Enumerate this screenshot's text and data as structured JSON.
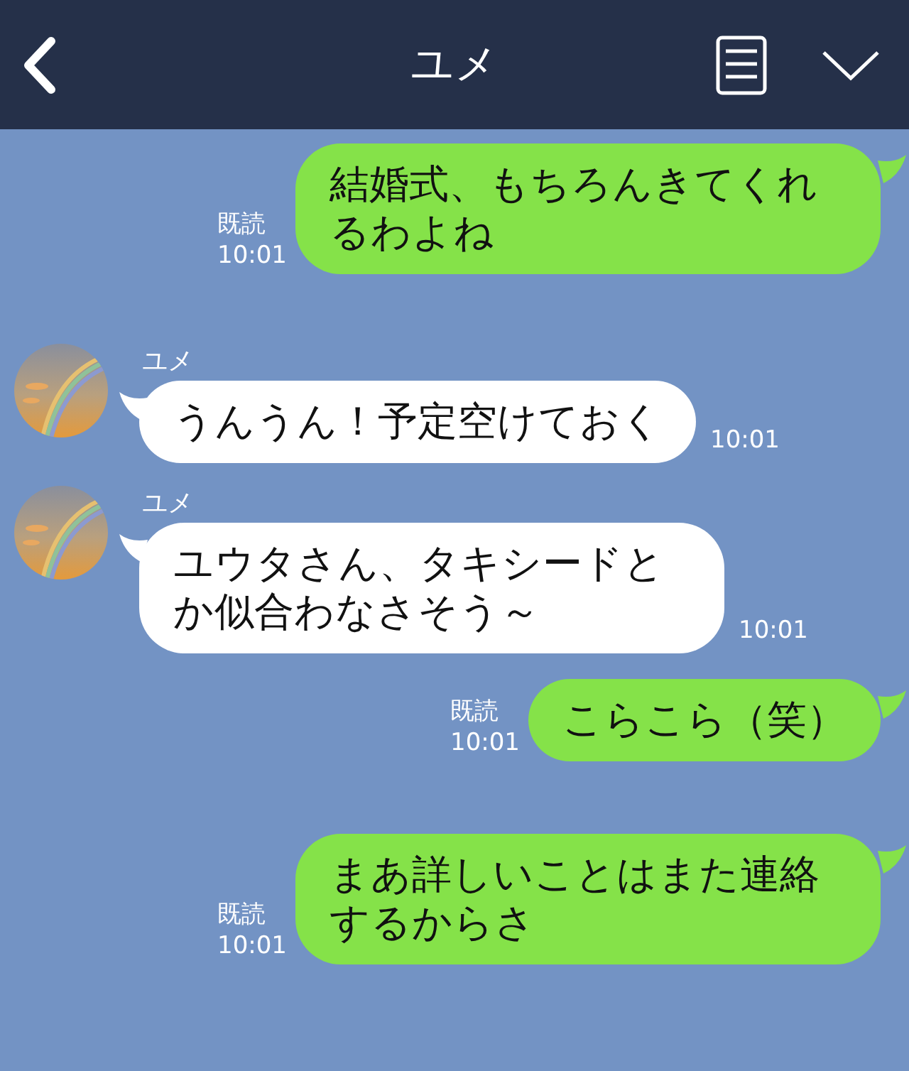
{
  "header": {
    "title": "ユメ"
  },
  "messages": [
    {
      "kind": "sent",
      "text": "結婚式、もちろんきてくれるわよね",
      "read": "既読",
      "time": "10:01"
    },
    {
      "kind": "received",
      "sender": "ユメ",
      "text": "うんうん！予定空けておく",
      "time": "10:01"
    },
    {
      "kind": "received",
      "sender": "ユメ",
      "text": "ユウタさん、タキシードとか似合わなさそう～",
      "time": "10:01"
    },
    {
      "kind": "sent",
      "text": "こらこら（笑）",
      "read": "既読",
      "time": "10:01"
    },
    {
      "kind": "sent",
      "text": "まあ詳しいことはまた連絡するからさ",
      "read": "既読",
      "time": "10:01"
    }
  ]
}
